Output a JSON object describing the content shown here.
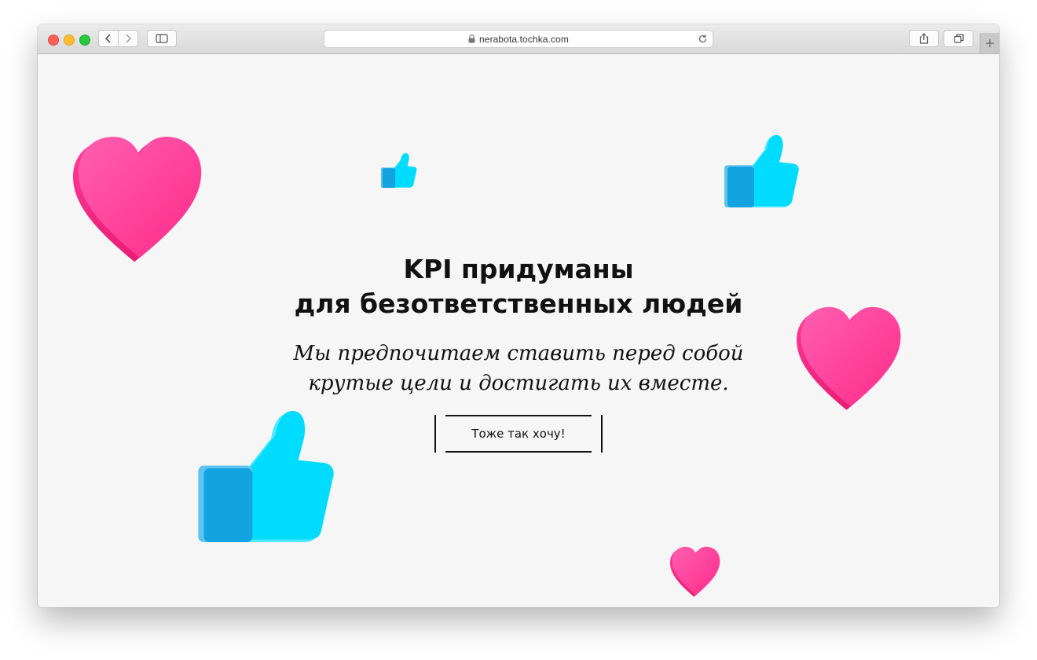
{
  "browser": {
    "url": "nerabota.tochka.com"
  },
  "page": {
    "headline_line1": "KPI придуманы",
    "headline_line2": "для безответственных людей",
    "subline_line1": "Мы предпочитаем ставить перед собой",
    "subline_line2": "крутые цели и достигать их вместе.",
    "cta_label": "Тоже так хочу!"
  },
  "colors": {
    "heart": "#ff3d9a",
    "thumb": "#00dcff",
    "thumb_cuff": "#12a3e0",
    "background": "#f6f6f6"
  },
  "icons": [
    "heart-icon",
    "thumbs-up-icon",
    "lock-icon",
    "reload-icon",
    "share-icon",
    "tabs-icon",
    "sidebar-icon",
    "back-icon",
    "forward-icon",
    "plus-icon"
  ]
}
